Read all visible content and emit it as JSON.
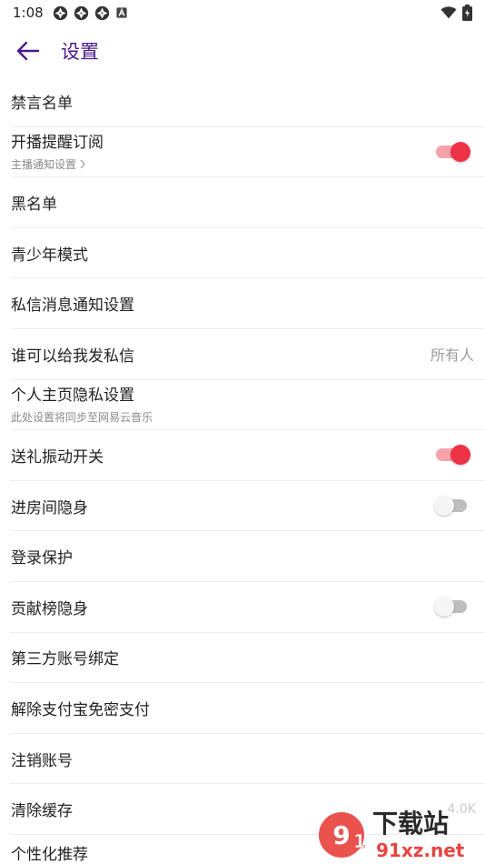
{
  "status_bar": {
    "time": "1:08",
    "left_icons": [
      "app-notification-icon",
      "app-notification-icon",
      "app-notification-icon",
      "a-notification-icon"
    ],
    "right_icons": [
      "wifi-icon",
      "battery-charging-icon"
    ]
  },
  "header": {
    "back_icon": "arrow-left-icon",
    "title": "设置",
    "title_color": "#4a1a8c"
  },
  "settings": {
    "mute_list": "禁言名单",
    "live_reminder": "开播提醒订阅",
    "live_reminder_sub": "主播通知设置",
    "live_reminder_on": true,
    "blacklist": "黑名单",
    "teen_mode": "青少年模式",
    "dm_notification": "私信消息通知设置",
    "who_can_dm": "谁可以给我发私信",
    "who_can_dm_value": "所有人",
    "homepage_privacy": "个人主页隐私设置",
    "homepage_privacy_sub": "此处设置将同步至网易云音乐",
    "gift_vibration": "送礼振动开关",
    "gift_vibration_on": true,
    "room_invisible": "进房间隐身",
    "room_invisible_on": false,
    "login_protection": "登录保护",
    "contribution_invisible": "贡献榜隐身",
    "contribution_invisible_on": false,
    "third_party_binding": "第三方账号绑定",
    "unbind_alipay": "解除支付宝免密支付",
    "cancel_account": "注销账号",
    "clear_cache": "清除缓存",
    "clear_cache_value": "4.0K",
    "personalized": "个性化推荐"
  },
  "colors": {
    "switch_on_thumb": "#ee3346",
    "switch_on_track": "#f6a2ab",
    "switch_off_thumb": "#f5f5f5",
    "switch_off_track": "#bdbdbd"
  },
  "watermark": {
    "logo_text": "下载站",
    "domain_text": "91xz.net"
  }
}
